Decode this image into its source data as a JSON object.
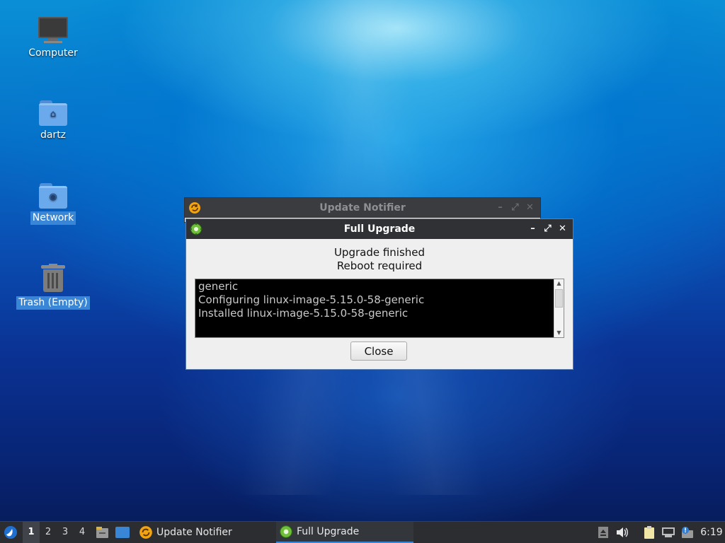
{
  "desktop": {
    "icons": [
      {
        "label": "Computer",
        "icon": "computer-icon"
      },
      {
        "label": "dartz",
        "icon": "home-folder-icon"
      },
      {
        "label": "Network",
        "icon": "network-folder-icon"
      },
      {
        "label": "Trash (Empty)",
        "icon": "trash-icon"
      }
    ]
  },
  "update_notifier": {
    "title": "Update Notifier"
  },
  "full_upgrade": {
    "title": "Full Upgrade",
    "status_line1": "Upgrade finished",
    "status_line2": "Reboot required",
    "log": [
      "generic",
      "Configuring linux-image-5.15.0-58-generic",
      "Installed linux-image-5.15.0-58-generic"
    ],
    "close_label": "Close",
    "controls": {
      "minimize": "–",
      "maximize": "⤢",
      "close": "✕"
    }
  },
  "taskbar": {
    "workspaces": [
      "1",
      "2",
      "3",
      "4"
    ],
    "tasks": [
      {
        "label": "Update Notifier"
      },
      {
        "label": "Full Upgrade"
      }
    ],
    "clock": "6:19"
  },
  "colors": {
    "accent": "#3a86d6",
    "titlebar": "#2f3134",
    "taskbar": "#2b2d30"
  }
}
